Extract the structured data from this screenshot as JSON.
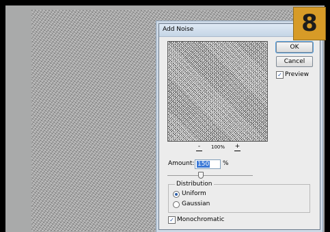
{
  "dialog": {
    "title": "Add Noise",
    "ok_label": "OK",
    "cancel_label": "Cancel",
    "preview_label": "Preview",
    "preview_checked": true,
    "zoom_out_label": "-",
    "zoom_in_label": "+",
    "zoom_level": "100%",
    "amount_label": "Amount:",
    "amount_value": "150",
    "amount_unit": "%",
    "distribution": {
      "legend": "Distribution",
      "options": [
        "Uniform",
        "Gaussian"
      ],
      "selected": "Uniform"
    },
    "monochromatic_label": "Monochromatic",
    "monochromatic_checked": true
  },
  "badge": {
    "number": "8",
    "color": "#d79b27"
  }
}
